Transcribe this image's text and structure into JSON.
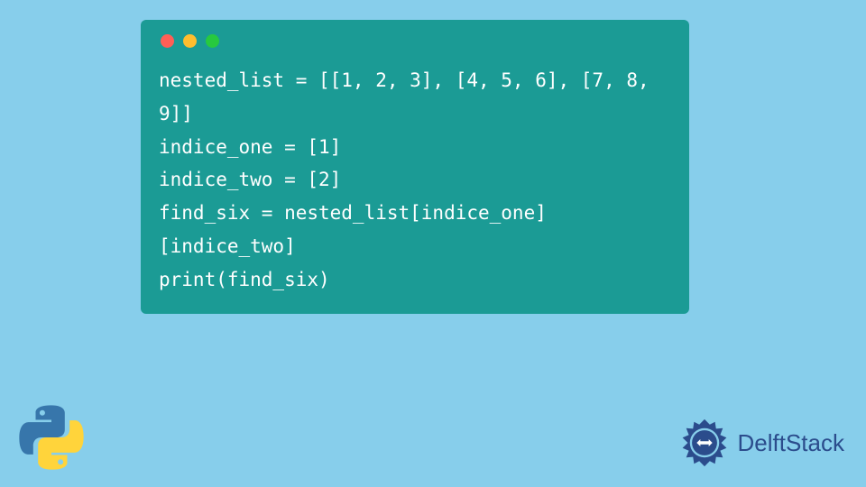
{
  "code": {
    "line1": "nested_list = [[1, 2, 3], [4, 5, 6], [7, 8, 9]]",
    "line2": "indice_one = [1]",
    "line3": "indice_two = [2]",
    "line4": "find_six = nested_list[indice_one][indice_two]",
    "line5": "print(find_six)"
  },
  "branding": {
    "name": "DelftStack"
  }
}
